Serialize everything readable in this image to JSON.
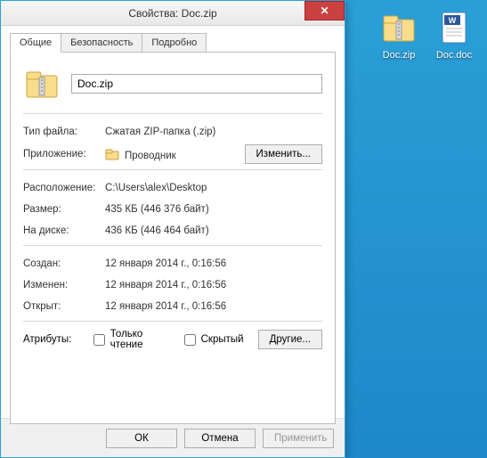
{
  "desktop": {
    "icons": [
      {
        "name": "Doc.zip",
        "type": "zip"
      },
      {
        "name": "Doc.doc",
        "type": "doc"
      }
    ]
  },
  "dialog": {
    "title": "Свойства: Doc.zip",
    "tabs": [
      "Общие",
      "Безопасность",
      "Подробно"
    ],
    "active_tab": 0,
    "filename": "Doc.zip",
    "rows": {
      "filetype_k": "Тип файла:",
      "filetype_v": "Сжатая ZIP-папка (.zip)",
      "app_k": "Приложение:",
      "app_v": "Проводник",
      "change_btn": "Изменить...",
      "location_k": "Расположение:",
      "location_v": "C:\\Users\\alex\\Desktop",
      "size_k": "Размер:",
      "size_v": "435 КБ (446 376 байт)",
      "ondisk_k": "На диске:",
      "ondisk_v": "436 КБ (446 464 байт)",
      "created_k": "Создан:",
      "created_v": "12 января 2014 г., 0:16:56",
      "modified_k": "Изменен:",
      "modified_v": "12 января 2014 г., 0:16:56",
      "accessed_k": "Открыт:",
      "accessed_v": "12 января 2014 г., 0:16:56",
      "attrs_k": "Атрибуты:",
      "readonly": "Только чтение",
      "hidden": "Скрытый",
      "other_btn": "Другие..."
    },
    "footer": {
      "ok": "ОК",
      "cancel": "Отмена",
      "apply": "Применить"
    }
  }
}
